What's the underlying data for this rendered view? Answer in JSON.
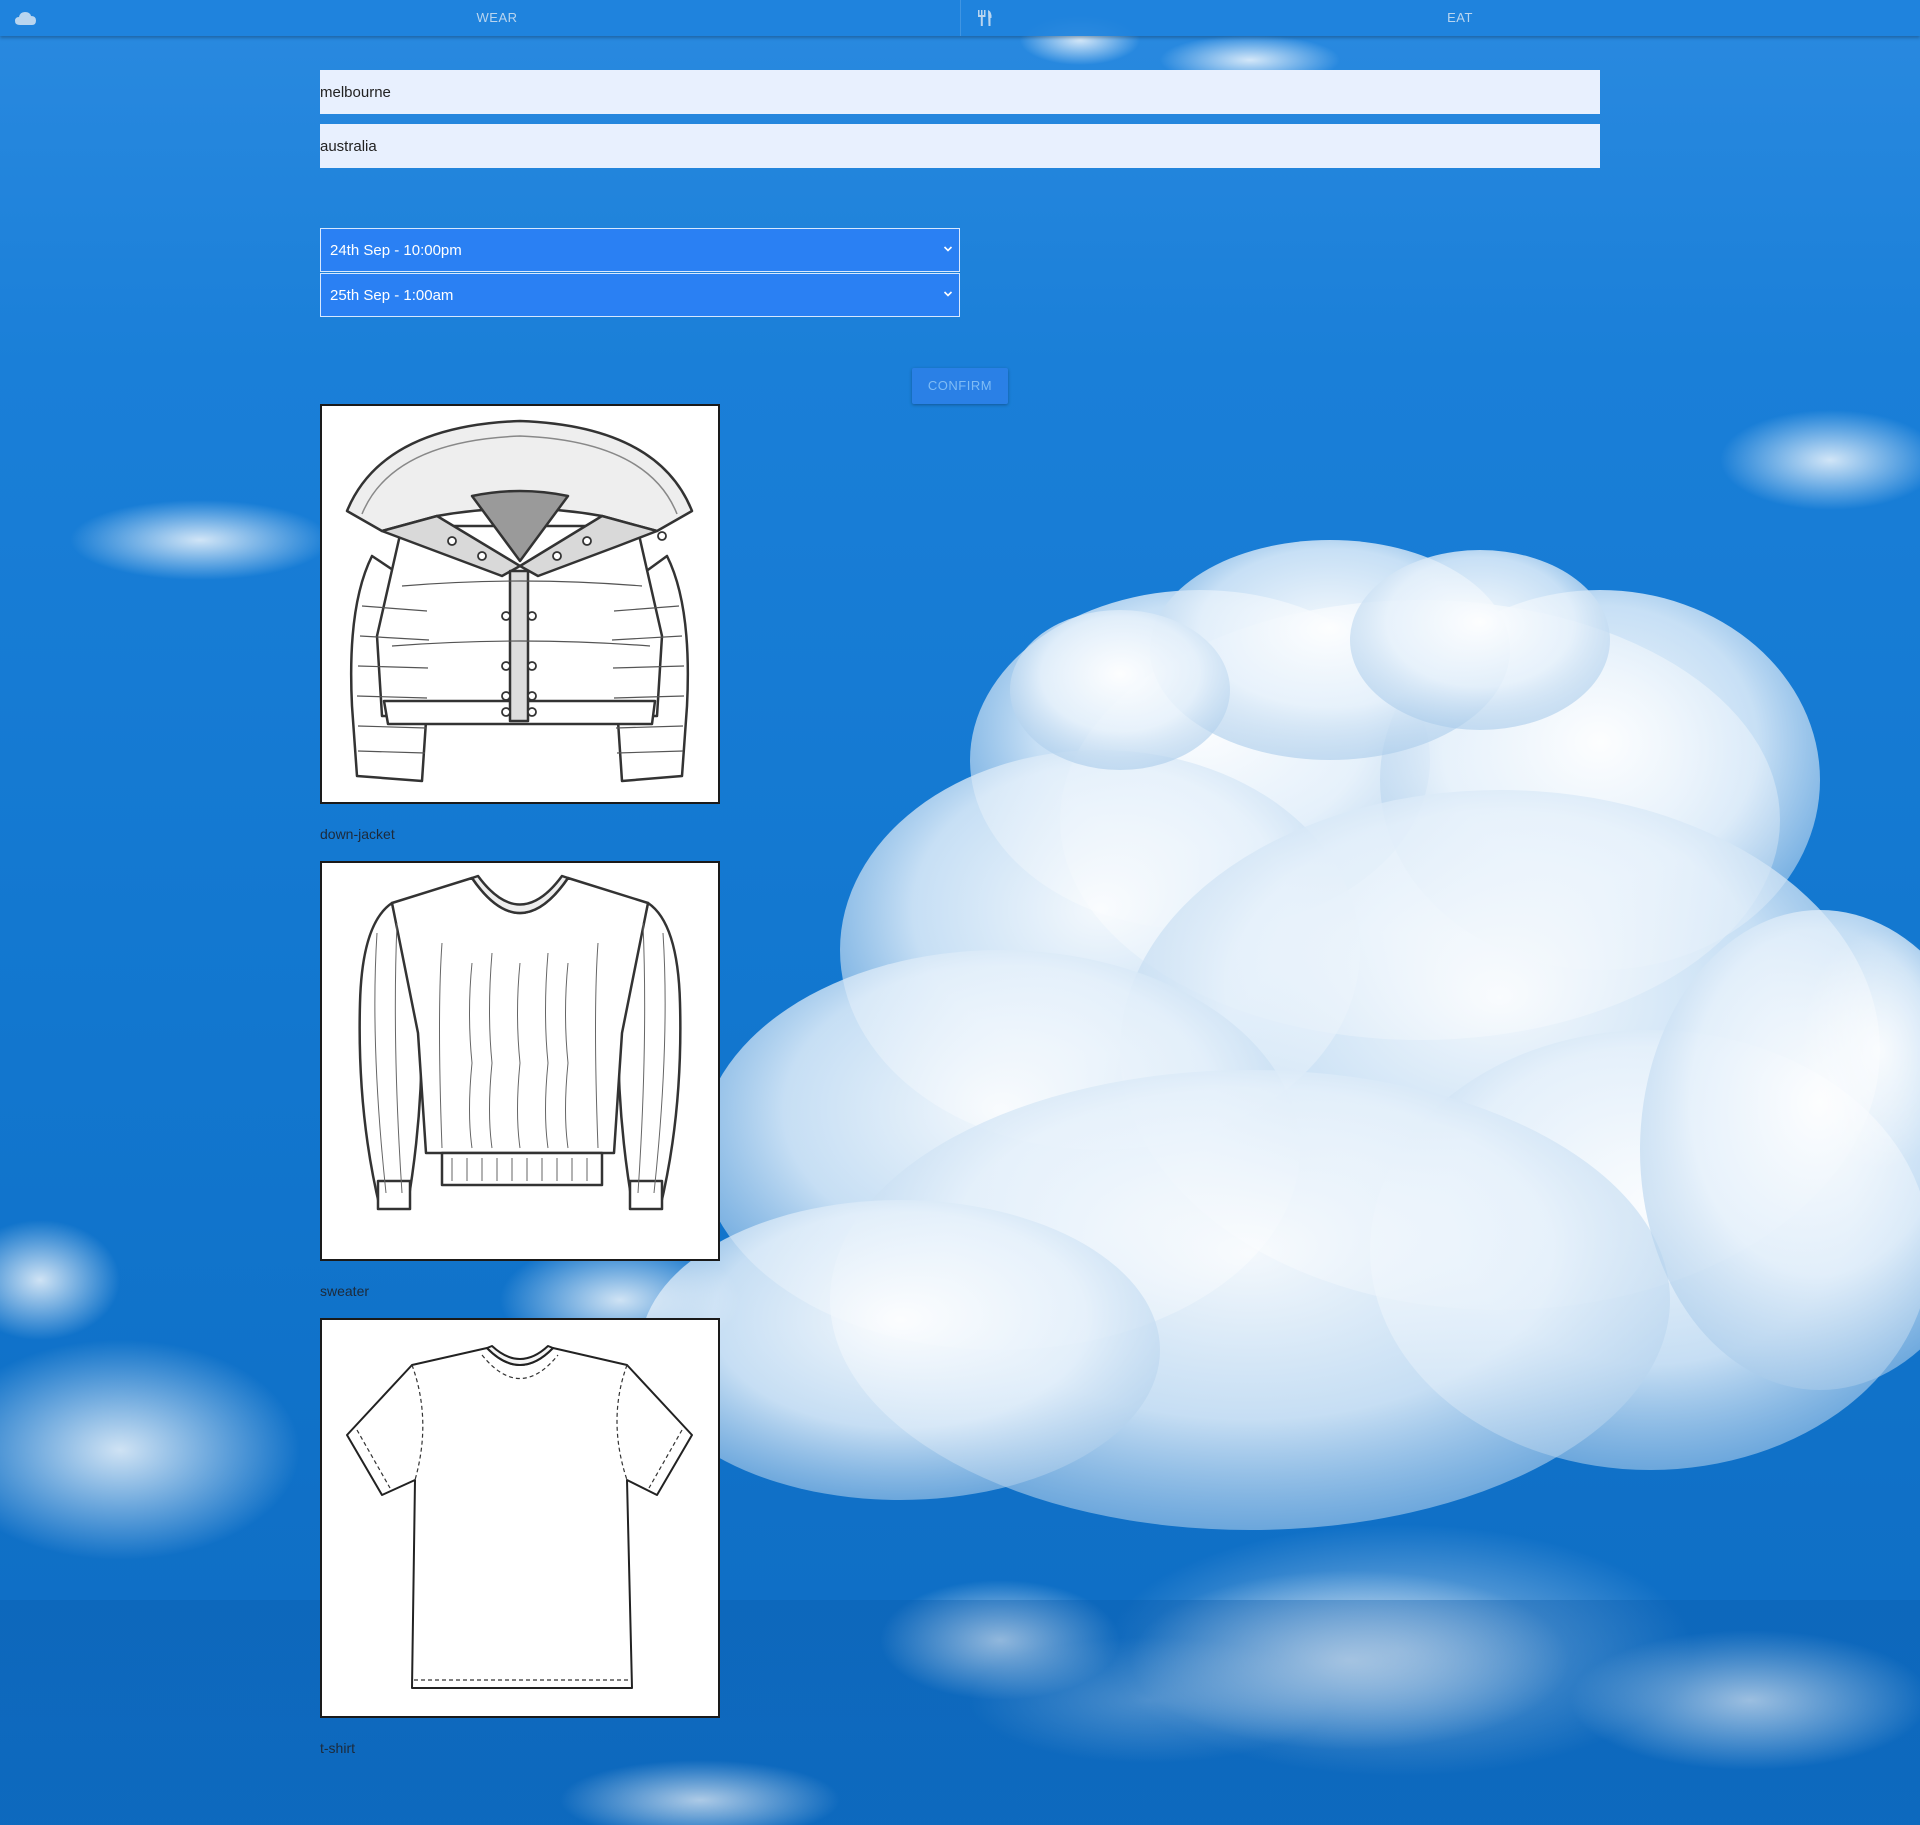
{
  "nav": {
    "brand_icon": "cloud-icon",
    "wear_label": "WEAR",
    "eat_icon": "fork-knife-icon",
    "eat_label": "EAT"
  },
  "form": {
    "city_value": "melbourne",
    "country_value": "australia",
    "start_time": "24th Sep - 10:00pm",
    "end_time": "25th Sep - 1:00am",
    "confirm_label": "CONFIRM"
  },
  "results": [
    {
      "name": "down-jacket",
      "icon": "down-jacket-illustration"
    },
    {
      "name": "sweater",
      "icon": "sweater-illustration"
    },
    {
      "name": "t-shirt",
      "icon": "t-shirt-illustration"
    }
  ],
  "colors": {
    "nav_bg": "#1e82dc",
    "input_bg": "#e8f0fe",
    "select_bg": "#2a80f3",
    "confirm_bg": "#2a80e6"
  }
}
